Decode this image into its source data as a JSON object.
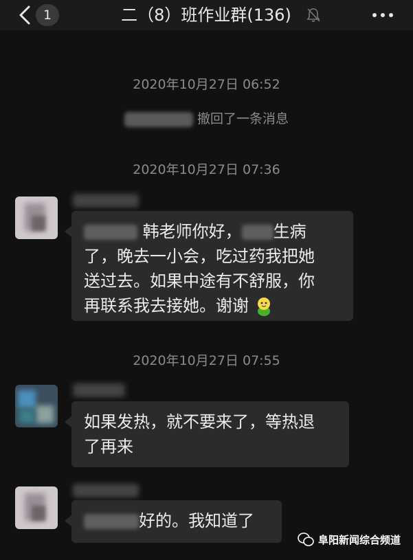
{
  "header": {
    "unread_count": "1",
    "title": "二（8）班作业群(136)",
    "back_icon": "chevron-left-icon",
    "mute_icon": "bell-muted-icon",
    "more_icon": "more-dots-icon"
  },
  "timestamps": [
    "2020年10月27日 06:52",
    "2020年10月27日 07:36",
    "2020年10月27日 07:55"
  ],
  "recall_text": "撤回了一条消息",
  "messages": [
    {
      "text_part1": "韩老师你好，",
      "text_part2": "生病",
      "text_part3": "了，晚去一小会，吃过药我把她",
      "text_part4": "送过去。如果中途有不舒服，你",
      "text_part5": "再联系我去接她。谢谢"
    },
    {
      "line1": "如果发热，就不要来了，等热退",
      "line2": "了再来"
    },
    {
      "text": "好的。我知道了"
    }
  ],
  "watermark": "阜阳新闻综合频道",
  "colors": {
    "background": "#111111",
    "bubble": "#2b2b2b",
    "text": "#ececec",
    "meta": "#8b8b8b"
  }
}
